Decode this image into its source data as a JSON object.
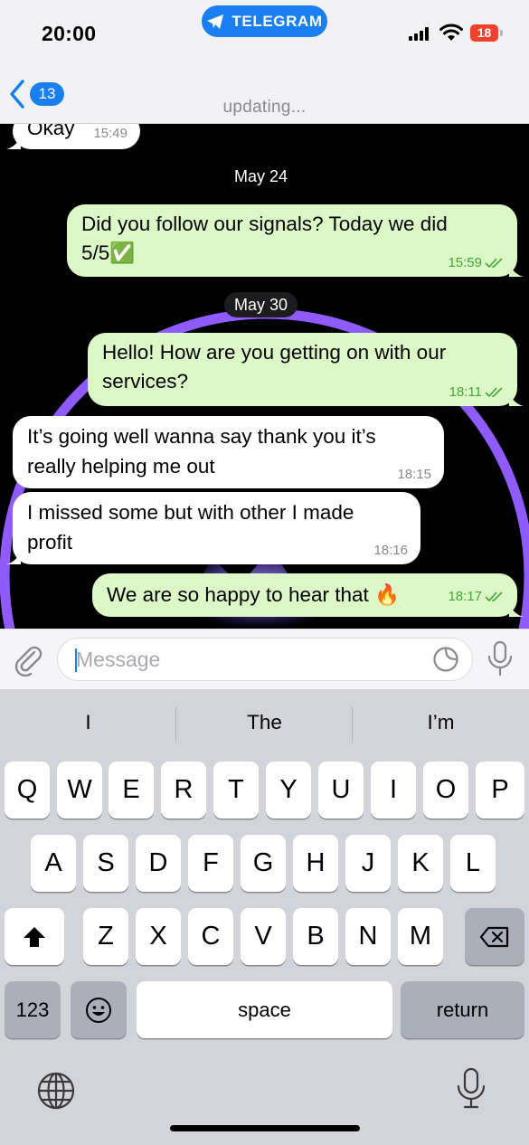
{
  "status_bar": {
    "time": "20:00",
    "app_pill": "TELEGRAM",
    "battery": "18"
  },
  "nav": {
    "back_badge": "13",
    "subtitle": "updating..."
  },
  "chat": {
    "messages": [
      {
        "direction": "in",
        "text": "Okay",
        "time": "15:49"
      },
      {
        "direction": "date",
        "text": "May 24"
      },
      {
        "direction": "out",
        "text": "Did you follow our signals? Today we did\n5/5✅",
        "time": "15:59"
      },
      {
        "direction": "date",
        "text": "May 30"
      },
      {
        "direction": "out",
        "text": "Hello! How are you getting on with our\nservices?",
        "time": "18:11"
      },
      {
        "direction": "in",
        "text": "It’s going well wanna say thank you it’s\nreally helping me out",
        "time": "18:15"
      },
      {
        "direction": "in",
        "text": "I missed some but with other I made\nprofit",
        "time": "18:16"
      },
      {
        "direction": "out",
        "text": "We are so happy to hear that 🔥",
        "time": "18:17"
      }
    ]
  },
  "composer": {
    "placeholder": "Message"
  },
  "keyboard": {
    "suggestions": [
      "I",
      "The",
      "I’m"
    ],
    "row1": [
      "Q",
      "W",
      "E",
      "R",
      "T",
      "Y",
      "U",
      "I",
      "O",
      "P"
    ],
    "row2": [
      "A",
      "S",
      "D",
      "F",
      "G",
      "H",
      "J",
      "K",
      "L"
    ],
    "row3": [
      "Z",
      "X",
      "C",
      "V",
      "B",
      "N",
      "M"
    ],
    "numbers_key": "123",
    "space_key": "space",
    "return_key": "return"
  },
  "colors": {
    "accent": "#1a7ff0",
    "outgoing_bubble": "#dcf8c6",
    "incoming_bubble": "#ffffff",
    "battery_low": "#f0412d",
    "read_ticks": "#46a63a"
  }
}
